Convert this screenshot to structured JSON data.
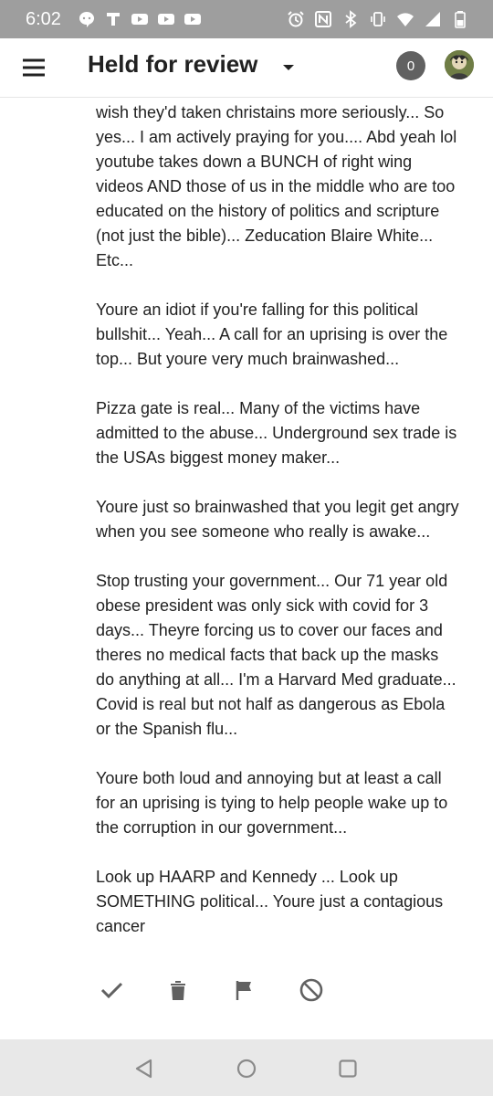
{
  "status_bar": {
    "time": "6:02",
    "left_icons": [
      "chat-bubble-icon",
      "t-icon",
      "youtube-icon",
      "youtube-icon",
      "youtube-icon"
    ],
    "right_icons": [
      "alarm-icon",
      "nfc-icon",
      "bluetooth-icon",
      "vibrate-icon",
      "wifi-icon",
      "signal-icon",
      "battery-icon"
    ]
  },
  "app_bar": {
    "menu_icon": "menu-icon",
    "title": "Held for review",
    "dropdown_icon": "caret-down-icon",
    "count": "0",
    "avatar": "avatar"
  },
  "comment": {
    "paragraphs": [
      "wish they'd taken christains more seriously... So yes... I am actively praying for you.... Abd yeah lol youtube takes down a BUNCH of right wing videos AND those of us in the middle who are too educated on the history of politics and scripture (not just the bible)... Zeducation Blaire White... Etc...",
      "Youre an idiot if you're falling for this political bullshit... Yeah... A call for an uprising is over the top... But youre very much brainwashed...",
      "Pizza gate is real... Many of the victims have admitted to the abuse... Underground sex trade is the USAs biggest money maker...",
      "Youre just so brainwashed that you legit get angry when you see someone who really is awake...",
      "Stop trusting your government... Our 71 year old obese president was only sick with covid for 3 days... Theyre forcing us to cover our faces and theres no medical facts that back up the masks do anything at all... I'm a Harvard Med graduate... Covid is real but not half as dangerous as Ebola or the Spanish flu...",
      "Youre both loud and annoying but at least a call for an uprising is tying to help people wake up to the corruption in our government...",
      "Look up HAARP and Kennedy ... Look up SOMETHING political... Youre just a contagious cancer"
    ]
  },
  "actions": [
    "approve-check-icon",
    "delete-trash-icon",
    "report-flag-icon",
    "block-icon"
  ],
  "nav_bar": [
    "back-triangle-icon",
    "home-circle-icon",
    "recents-square-icon"
  ]
}
